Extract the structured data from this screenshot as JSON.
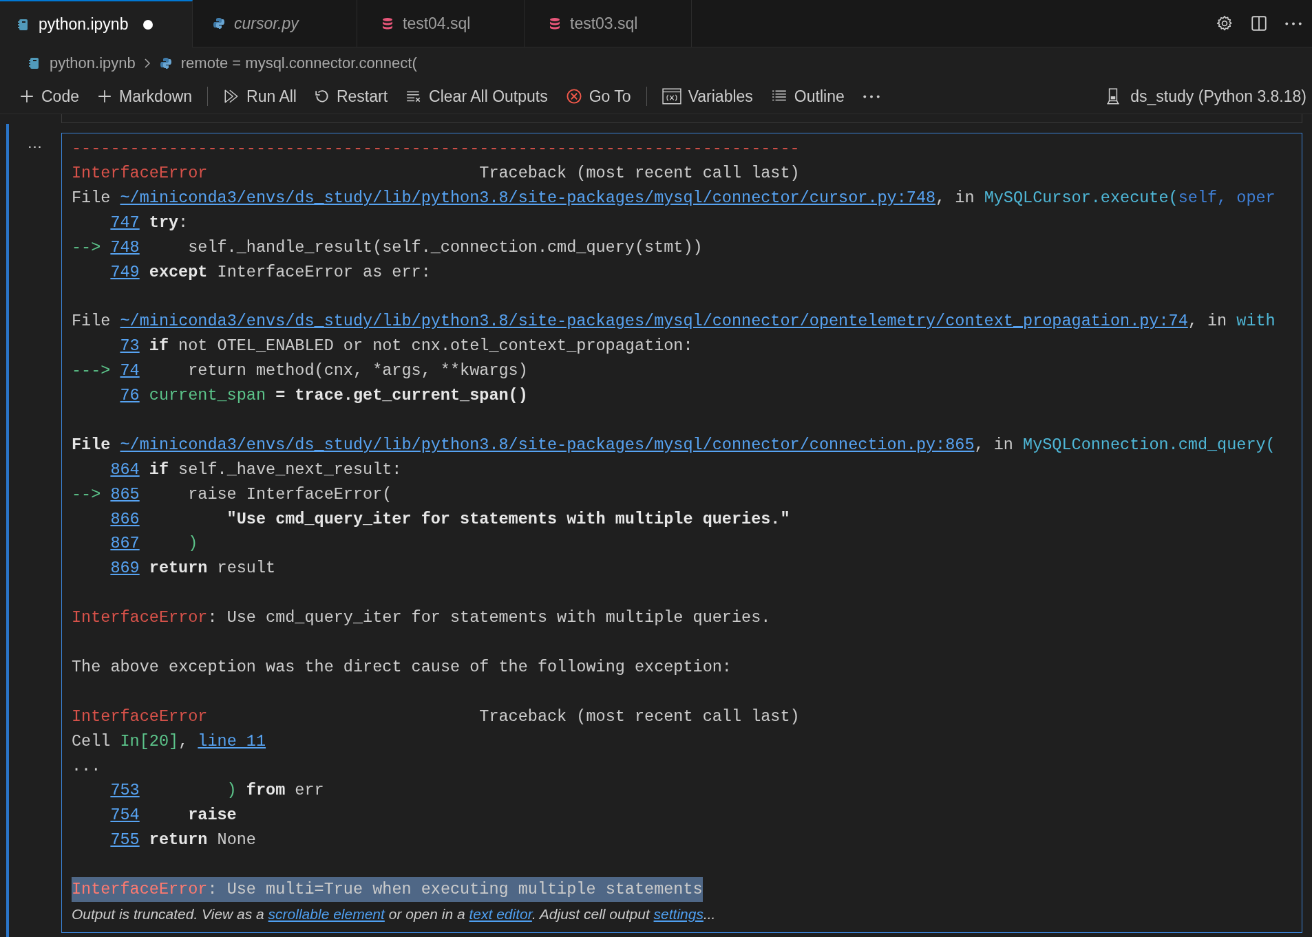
{
  "tabs": [
    {
      "label": "python.ipynb",
      "kind": "notebook",
      "selected": true,
      "dirty": true,
      "preview": false
    },
    {
      "label": "cursor.py",
      "kind": "python",
      "selected": false,
      "dirty": false,
      "preview": true
    },
    {
      "label": "test04.sql",
      "kind": "database",
      "selected": false,
      "dirty": false,
      "preview": false
    },
    {
      "label": "test03.sql",
      "kind": "database",
      "selected": false,
      "dirty": false,
      "preview": false
    }
  ],
  "breadcrumb": [
    {
      "label": "python.ipynb",
      "kind": "notebook"
    },
    {
      "label": "remote = mysql.connector.connect(",
      "kind": "python"
    }
  ],
  "toolbar": [
    {
      "kind": "plus",
      "label": "Code"
    },
    {
      "kind": "plus",
      "label": "Markdown"
    },
    {
      "kind": "separator"
    },
    {
      "kind": "run-all",
      "label": "Run All"
    },
    {
      "kind": "restart",
      "label": "Restart"
    },
    {
      "kind": "clear",
      "label": "Clear All Outputs"
    },
    {
      "kind": "error",
      "label": "Go To"
    },
    {
      "kind": "separator"
    },
    {
      "kind": "variables",
      "label": "Variables"
    },
    {
      "kind": "outline",
      "label": "Outline"
    },
    {
      "kind": "more"
    },
    {
      "kind": "kernel",
      "label": "ds_study (Python 3.8.18)"
    }
  ],
  "output": {
    "blocks": [
      {
        "lines": [
          {
            "highlighted": false,
            "segments": [
              {
                "kind": "red",
                "text": "---------------------------------------------------------------------------"
              }
            ]
          },
          {
            "highlighted": false,
            "segments": [
              {
                "kind": "red",
                "text": "InterfaceError"
              },
              {
                "kind": "text",
                "text": "                            Traceback (most recent call last)"
              }
            ]
          },
          {
            "highlighted": false,
            "segments": [
              {
                "kind": "text",
                "text": "File "
              },
              {
                "kind": "link",
                "text": "~/miniconda3/envs/ds_study/lib/python3.8/site-packages/mysql/connector/cursor.py:748"
              },
              {
                "kind": "text",
                "text": ", in "
              },
              {
                "kind": "cyan",
                "text": "MySQLCursor.execute("
              },
              {
                "kind": "blue",
                "text": "self, oper"
              }
            ]
          },
          {
            "highlighted": false,
            "lineno": "747",
            "segments": [
              {
                "kind": "bold",
                "text": "try"
              },
              {
                "kind": "text",
                "text": ":"
              }
            ]
          },
          {
            "highlighted": false,
            "arrow": "-->",
            "lineno": "748",
            "segments": [
              {
                "kind": "text",
                "text": "    self._handle_result(self._connection.cmd_query(stmt))"
              }
            ]
          },
          {
            "highlighted": false,
            "lineno": "749",
            "segments": [
              {
                "kind": "bold",
                "text": "except"
              },
              {
                "kind": "text",
                "text": " InterfaceError as err:"
              }
            ]
          }
        ]
      },
      {
        "lines": [
          {
            "highlighted": false,
            "segments": [
              {
                "kind": "text",
                "text": "File "
              },
              {
                "kind": "link",
                "text": "~/miniconda3/envs/ds_study/lib/python3.8/site-packages/mysql/connector/opentelemetry/context_propagation.py:74"
              },
              {
                "kind": "text",
                "text": ", in "
              },
              {
                "kind": "cyan",
                "text": "with"
              }
            ]
          },
          {
            "highlighted": false,
            "lineno": "73",
            "segments": [
              {
                "kind": "bold",
                "text": "if"
              },
              {
                "kind": "text",
                "text": " not OTEL_ENABLED or not cnx.otel_context_propagation:"
              }
            ]
          },
          {
            "highlighted": false,
            "arrow": "--->",
            "lineno": "74",
            "segments": [
              {
                "kind": "text",
                "text": "    return method(cnx, *args, **kwargs)"
              }
            ]
          },
          {
            "highlighted": false,
            "lineno": "76",
            "segments": [
              {
                "kind": "green",
                "text": "current_span"
              },
              {
                "kind": "bold",
                "text": " = trace.get_current_span()"
              }
            ]
          }
        ]
      },
      {
        "lines": [
          {
            "highlighted": false,
            "segments": [
              {
                "kind": "bold",
                "text": "File "
              },
              {
                "kind": "link",
                "text": "~/miniconda3/envs/ds_study/lib/python3.8/site-packages/mysql/connector/connection.py:865"
              },
              {
                "kind": "text",
                "text": ", in "
              },
              {
                "kind": "cyan",
                "text": "MySQLConnection.cmd_query("
              }
            ]
          },
          {
            "highlighted": false,
            "lineno": "864",
            "segments": [
              {
                "kind": "bold",
                "text": "if"
              },
              {
                "kind": "text",
                "text": " self._have_next_result:"
              }
            ]
          },
          {
            "highlighted": false,
            "arrow": "-->",
            "lineno": "865",
            "segments": [
              {
                "kind": "text",
                "text": "    raise InterfaceError("
              }
            ]
          },
          {
            "highlighted": false,
            "lineno": "866",
            "segments": [
              {
                "kind": "bold",
                "text": "        \"Use cmd_query_iter for statements with multiple queries.\""
              }
            ]
          },
          {
            "highlighted": false,
            "lineno": "867",
            "segments": [
              {
                "kind": "green",
                "text": "    )"
              }
            ]
          },
          {
            "highlighted": false,
            "lineno": "869",
            "segments": [
              {
                "kind": "bold",
                "text": "return"
              },
              {
                "kind": "text",
                "text": " result"
              }
            ]
          }
        ]
      },
      {
        "lines": [
          {
            "highlighted": false,
            "segments": [
              {
                "kind": "red",
                "text": "InterfaceError"
              },
              {
                "kind": "text",
                "text": ": Use cmd_query_iter for statements with multiple queries."
              }
            ]
          }
        ]
      },
      {
        "lines": [
          {
            "highlighted": false,
            "segments": [
              {
                "kind": "text",
                "text": "The above exception was the direct cause of the following exception:"
              }
            ]
          }
        ]
      },
      {
        "lines": [
          {
            "highlighted": false,
            "segments": [
              {
                "kind": "red",
                "text": "InterfaceError"
              },
              {
                "kind": "text",
                "text": "                            Traceback (most recent call last)"
              }
            ]
          },
          {
            "highlighted": false,
            "segments": [
              {
                "kind": "text",
                "text": "Cell "
              },
              {
                "kind": "green",
                "text": "In[20]"
              },
              {
                "kind": "text",
                "text": ", "
              },
              {
                "kind": "link",
                "text": "line 11"
              }
            ]
          },
          {
            "highlighted": false,
            "segments": [
              {
                "kind": "text",
                "text": "..."
              }
            ]
          },
          {
            "highlighted": false,
            "lineno": "753",
            "segments": [
              {
                "kind": "green",
                "text": "        )"
              },
              {
                "kind": "bold",
                "text": " from"
              },
              {
                "kind": "text",
                "text": " err"
              }
            ]
          },
          {
            "highlighted": false,
            "lineno": "754",
            "segments": [
              {
                "kind": "bold",
                "text": "    raise"
              }
            ]
          },
          {
            "highlighted": false,
            "lineno": "755",
            "segments": [
              {
                "kind": "bold",
                "text": "return"
              },
              {
                "kind": "text",
                "text": " None"
              }
            ]
          }
        ]
      },
      {
        "lines": [
          {
            "highlighted": true,
            "segments": [
              {
                "kind": "red",
                "text": "InterfaceError"
              },
              {
                "kind": "text",
                "text": ": Use multi=True when executing multiple statements"
              }
            ]
          }
        ]
      }
    ],
    "note": [
      {
        "kind": "text",
        "text": "Output is truncated. View as a "
      },
      {
        "kind": "link",
        "text": "scrollable element"
      },
      {
        "kind": "text",
        "text": " or open in a "
      },
      {
        "kind": "link",
        "text": "text editor"
      },
      {
        "kind": "text",
        "text": ". Adjust cell output "
      },
      {
        "kind": "link",
        "text": "settings"
      },
      {
        "kind": "text",
        "text": "..."
      }
    ]
  },
  "cell_menu": "..."
}
